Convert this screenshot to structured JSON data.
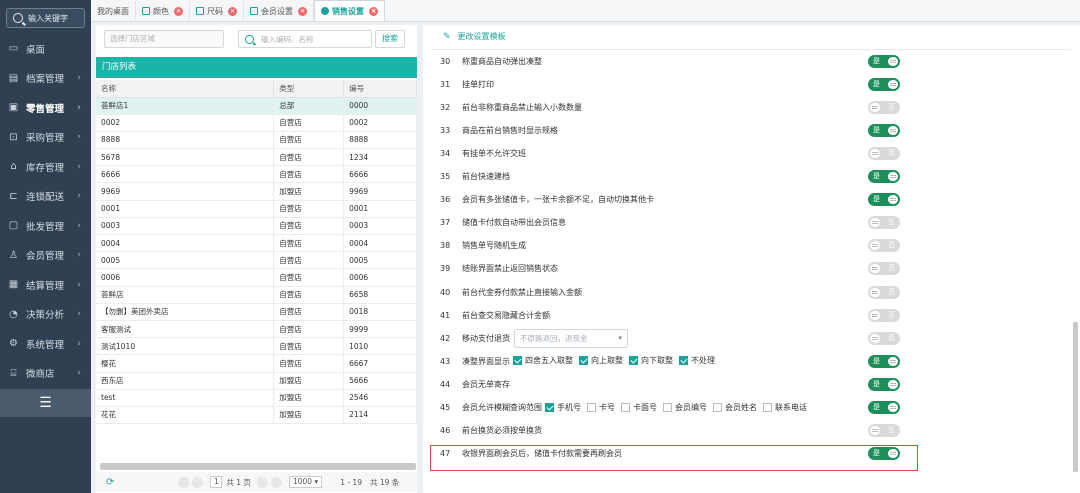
{
  "sidebar": {
    "search_placeholder": "输入关键字",
    "items": [
      {
        "label": "桌面",
        "icon": "monitor-icon",
        "has_chevron": false,
        "active": false
      },
      {
        "label": "档案管理",
        "icon": "file-icon",
        "has_chevron": true,
        "active": false
      },
      {
        "label": "零售管理",
        "icon": "cash-register-icon",
        "has_chevron": true,
        "active": true
      },
      {
        "label": "采购管理",
        "icon": "cart-icon",
        "has_chevron": true,
        "active": false
      },
      {
        "label": "库存管理",
        "icon": "warehouse-icon",
        "has_chevron": true,
        "active": false
      },
      {
        "label": "连锁配送",
        "icon": "truck-icon",
        "has_chevron": true,
        "active": false
      },
      {
        "label": "批发管理",
        "icon": "box-icon",
        "has_chevron": true,
        "active": false
      },
      {
        "label": "会员管理",
        "icon": "user-icon",
        "has_chevron": true,
        "active": false
      },
      {
        "label": "结算管理",
        "icon": "ledger-icon",
        "has_chevron": true,
        "active": false
      },
      {
        "label": "决策分析",
        "icon": "chart-icon",
        "has_chevron": true,
        "active": false
      },
      {
        "label": "系统管理",
        "icon": "gear-icon",
        "has_chevron": true,
        "active": false
      },
      {
        "label": "微商店",
        "icon": "shop-icon",
        "has_chevron": true,
        "active": false
      }
    ],
    "collapse_icon": "menu-icon"
  },
  "tabs": [
    {
      "label": "我的桌面",
      "closable": false,
      "active": false
    },
    {
      "label": "颜色",
      "closable": true,
      "active": false
    },
    {
      "label": "尺码",
      "closable": true,
      "active": false
    },
    {
      "label": "会员设置",
      "closable": true,
      "active": false
    },
    {
      "label": "销售设置",
      "closable": true,
      "active": true
    }
  ],
  "left_panel": {
    "store_filter_placeholder": "选择门店区域",
    "code_search_placeholder": "输入编码、名称",
    "search_button": "搜索",
    "store_list_title": "门店列表",
    "columns": [
      "名称",
      "类型",
      "编号"
    ],
    "rows": [
      [
        "荟鲜店1",
        "总部",
        "0000"
      ],
      [
        "0002",
        "自营店",
        "0002"
      ],
      [
        "8888",
        "自营店",
        "8888"
      ],
      [
        "5678",
        "自营店",
        "1234"
      ],
      [
        "6666",
        "自营店",
        "6666"
      ],
      [
        "9969",
        "加盟店",
        "9969"
      ],
      [
        "0001",
        "自营店",
        "0001"
      ],
      [
        "0003",
        "自营店",
        "0003"
      ],
      [
        "0004",
        "自营店",
        "0004"
      ],
      [
        "0005",
        "自营店",
        "0005"
      ],
      [
        "0006",
        "自营店",
        "0006"
      ],
      [
        "荟鲜店",
        "自营店",
        "6658"
      ],
      [
        "【勿删】美团外卖店",
        "自营店",
        "0018"
      ],
      [
        "客服测试",
        "自营店",
        "9999"
      ],
      [
        "测试1010",
        "自营店",
        "1010"
      ],
      [
        "樱花",
        "自营店",
        "6667"
      ],
      [
        "西东店",
        "加盟店",
        "5666"
      ],
      [
        "test",
        "加盟店",
        "2546"
      ],
      [
        "花花",
        "加盟店",
        "2114"
      ]
    ],
    "selected_row_index": 0,
    "pager": {
      "page_input": "1",
      "page_total_text": "共 1 页",
      "page_size": "1000",
      "range_text": "1 - 19",
      "total_text": "共 19 条"
    }
  },
  "right_panel": {
    "change_template_label": "更改设置模板",
    "toggle_on_label": "是",
    "toggle_off_label": "否",
    "settings": [
      {
        "num": "30",
        "label": "称重商品自动弹出凑整",
        "on": true
      },
      {
        "num": "31",
        "label": "挂单打印",
        "on": true
      },
      {
        "num": "32",
        "label": "前台非称重商品禁止输入小数数量",
        "on": false
      },
      {
        "num": "33",
        "label": "商品在前台销售时显示规格",
        "on": true
      },
      {
        "num": "34",
        "label": "有挂单不允许交班",
        "on": false
      },
      {
        "num": "35",
        "label": "前台快速建档",
        "on": true
      },
      {
        "num": "36",
        "label": "会员有多张储值卡，一张卡余额不足，自动切换其他卡",
        "on": true
      },
      {
        "num": "37",
        "label": "储值卡付款自动带出会员信息",
        "on": false
      },
      {
        "num": "38",
        "label": "销售单号随机生成",
        "on": false
      },
      {
        "num": "39",
        "label": "结账界面禁止返回销售状态",
        "on": false
      },
      {
        "num": "40",
        "label": "前台代金券付款禁止直接输入金额",
        "on": false
      },
      {
        "num": "41",
        "label": "前台查交易隐藏合计金额",
        "on": false
      },
      {
        "num": "42",
        "label": "移动支付退货",
        "on": false,
        "select_value": "不原路退回，退现金"
      },
      {
        "num": "43",
        "label": "凑整界面显示",
        "on": true,
        "checkboxes": [
          {
            "label": "四舍五入取整",
            "checked": true
          },
          {
            "label": "向上取整",
            "checked": true
          },
          {
            "label": "向下取整",
            "checked": true
          },
          {
            "label": "不处理",
            "checked": true
          }
        ]
      },
      {
        "num": "44",
        "label": "会员无单寄存",
        "on": true
      },
      {
        "num": "45",
        "label": "会员允许模糊查询范围",
        "on": true,
        "checkboxes": [
          {
            "label": "手机号",
            "checked": true
          },
          {
            "label": "卡号",
            "checked": false
          },
          {
            "label": "卡面号",
            "checked": false
          },
          {
            "label": "会员编号",
            "checked": false
          },
          {
            "label": "会员姓名",
            "checked": false
          },
          {
            "label": "联系电话",
            "checked": false
          }
        ]
      },
      {
        "num": "46",
        "label": "前台换货必须按单换货",
        "on": false
      },
      {
        "num": "47",
        "label": "收银界面刷会员后，储值卡付款需要再刷会员",
        "on": true,
        "highlighted": true
      }
    ]
  },
  "colors": {
    "sidebar_bg": "#2f4052",
    "accent": "#1aa39a",
    "header_teal": "#1ab5a8",
    "toggle_on": "#1e8f5a",
    "toggle_off": "#d9d9d9",
    "highlight_border": "#e0473b",
    "tab_close": "#e9686a"
  }
}
